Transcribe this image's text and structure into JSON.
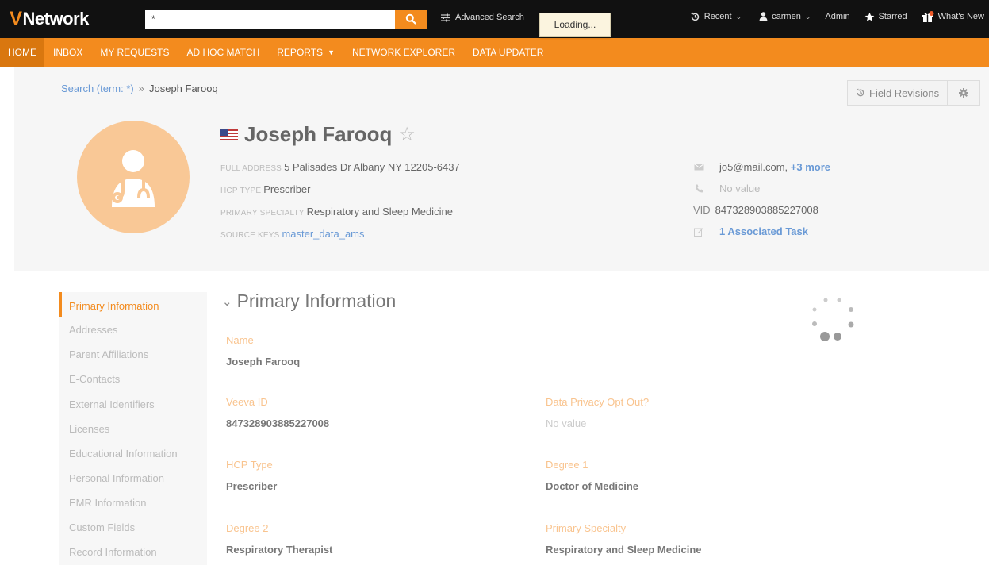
{
  "app": {
    "logo_text": "Network"
  },
  "search": {
    "value": "*"
  },
  "topbar": {
    "advanced_search": "Advanced Search",
    "loading": "Loading...",
    "recent": "Recent",
    "user": "carmen",
    "admin": "Admin",
    "starred": "Starred",
    "whats_new": "What's New"
  },
  "nav": {
    "items": [
      "HOME",
      "INBOX",
      "MY REQUESTS",
      "AD HOC MATCH",
      "REPORTS",
      "NETWORK EXPLORER",
      "DATA UPDATER"
    ]
  },
  "breadcrumb": {
    "link": "Search (term: *)",
    "sep": "»",
    "current": "Joseph Farooq"
  },
  "toolbar": {
    "field_revisions": "Field Revisions"
  },
  "profile": {
    "name": "Joseph Farooq",
    "address_label": "FULL ADDRESS",
    "address": "5 Palisades Dr Albany NY 12205-6437",
    "hcp_type_label": "HCP TYPE",
    "hcp_type": "Prescriber",
    "specialty_label": "PRIMARY SPECIALTY",
    "specialty": "Respiratory and Sleep Medicine",
    "source_keys_label": "SOURCE KEYS",
    "source_keys": "master_data_ams"
  },
  "contact": {
    "email": "jo5@mail.com,",
    "email_more": "+3 more",
    "phone": "No value",
    "vid_label": "VID",
    "vid": "847328903885227008",
    "tasks": "1 Associated Task"
  },
  "sidemenu": {
    "items": [
      "Primary Information",
      "Addresses",
      "Parent Affiliations",
      "E-Contacts",
      "External Identifiers",
      "Licenses",
      "Educational Information",
      "Personal Information",
      "EMR Information",
      "Custom Fields",
      "Record Information"
    ]
  },
  "section": {
    "title": "Primary Information"
  },
  "fields": {
    "name_label": "Name",
    "name_value": "Joseph Farooq",
    "veeva_id_label": "Veeva ID",
    "veeva_id_value": "847328903885227008",
    "privacy_label": "Data Privacy Opt Out?",
    "privacy_value": "No value",
    "hcp_type_label": "HCP Type",
    "hcp_type_value": "Prescriber",
    "degree1_label": "Degree 1",
    "degree1_value": "Doctor of Medicine",
    "degree2_label": "Degree 2",
    "degree2_value": "Respiratory Therapist",
    "specialty_label": "Primary Specialty",
    "specialty_value": "Respiratory and Sleep Medicine"
  },
  "colors": {
    "brand_orange": "#f38b1e",
    "link_blue": "#6a9ad6",
    "avatar": "#f9c896"
  }
}
